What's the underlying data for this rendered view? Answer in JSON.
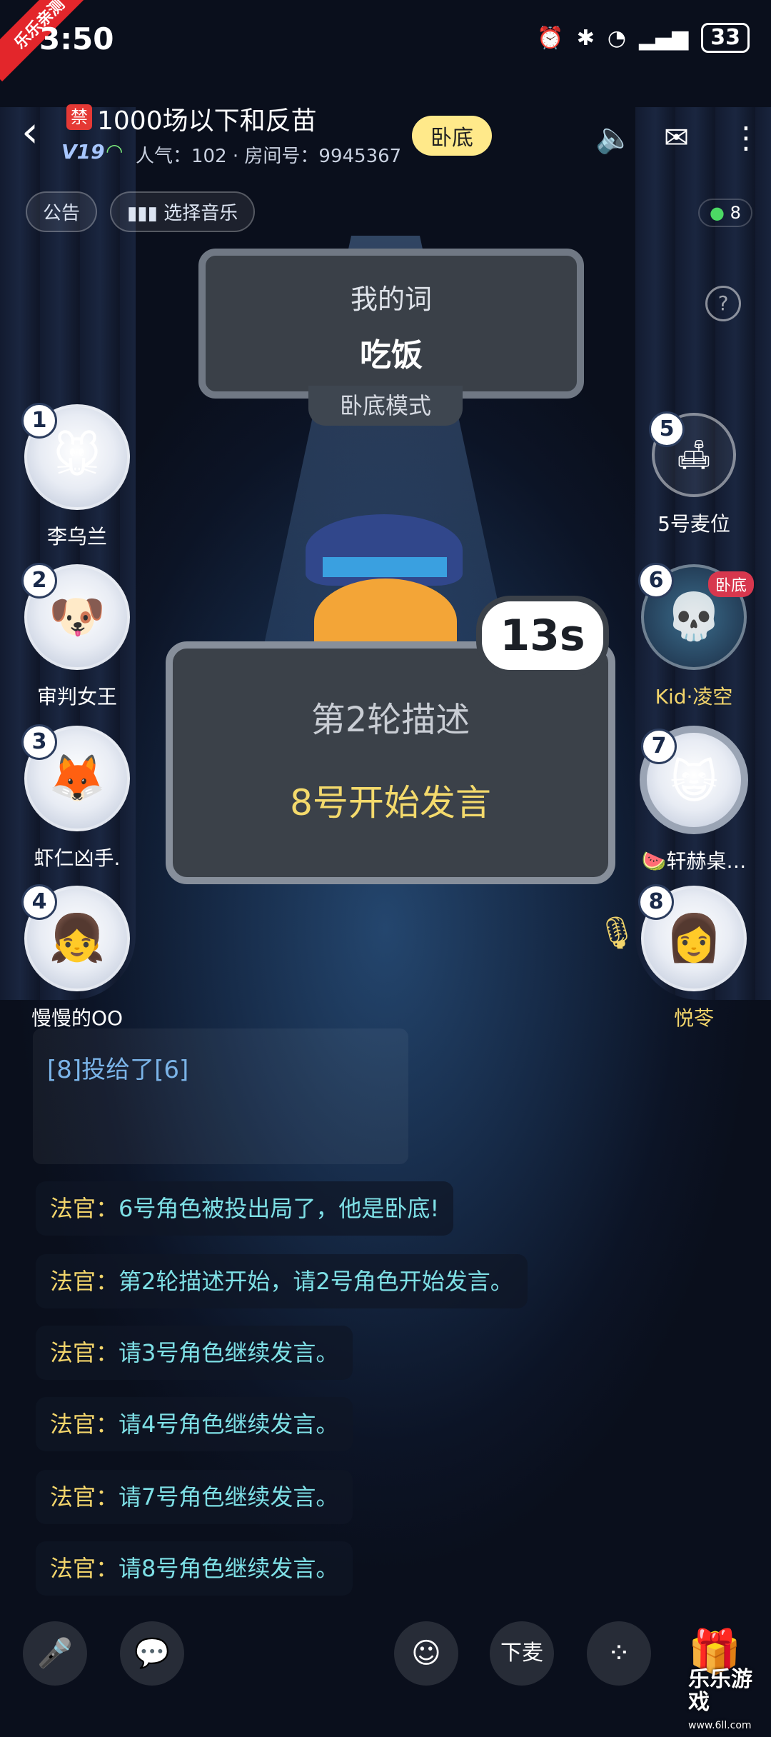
{
  "status_bar": {
    "time": "3:50",
    "battery": "33",
    "corner_tag": "乐乐亲测"
  },
  "header": {
    "ban_label": "禁",
    "room_title": "1000场以下和反苗",
    "level_badge": "V19",
    "meta": "人气：102 · 房间号：9945367",
    "mode_pill": "卧底"
  },
  "toolbar": {
    "notice": "公告",
    "music": "选择音乐",
    "online_count": "8",
    "help": "?"
  },
  "word_card": {
    "label": "我的词",
    "value": "吃饭",
    "mode_tag": "卧底模式"
  },
  "seats": [
    {
      "num": "1",
      "name": "李乌兰",
      "side": "left"
    },
    {
      "num": "2",
      "name": "审判女王",
      "side": "left"
    },
    {
      "num": "3",
      "name": "虾仁凶手.",
      "side": "left"
    },
    {
      "num": "4",
      "name": "慢慢的OO",
      "side": "left"
    },
    {
      "num": "5",
      "name": "5号麦位",
      "side": "right"
    },
    {
      "num": "6",
      "name": "Kid·凌空",
      "side": "right",
      "tag": "卧底"
    },
    {
      "num": "7",
      "name": "🍉轩赫桌…",
      "side": "right"
    },
    {
      "num": "8",
      "name": "悦苓",
      "side": "right"
    }
  ],
  "round_card": {
    "round": "第2轮描述",
    "speaker": "8号开始发言",
    "timer": "13s"
  },
  "chat": {
    "vote": "[8]投给了[6]",
    "messages": [
      {
        "who": "法官：",
        "text": "6号角色被投出局了，他是卧底!"
      },
      {
        "who": "法官：",
        "text": "第2轮描述开始，请2号角色开始发言。"
      },
      {
        "who": "法官：",
        "text": "请3号角色继续发言。"
      },
      {
        "who": "法官：",
        "text": "请4号角色继续发言。"
      },
      {
        "who": "法官：",
        "text": "请7号角色继续发言。"
      },
      {
        "who": "法官：",
        "text": "请8号角色继续发言。"
      }
    ]
  },
  "bottom_bar": {
    "leave_mic": "下麦"
  },
  "watermark": {
    "name": "乐乐游戏",
    "url": "www.6ll.com"
  }
}
